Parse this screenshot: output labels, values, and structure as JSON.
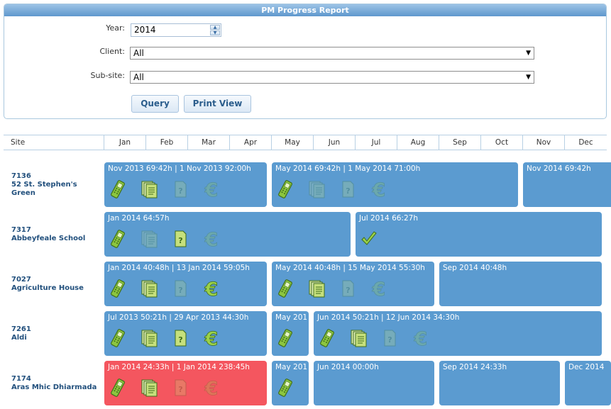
{
  "panel": {
    "title": "PM Progress Report",
    "year_label": "Year:",
    "year_value": "2014",
    "client_label": "Client:",
    "client_value": "All",
    "subsite_label": "Sub-site:",
    "subsite_value": "All",
    "query_button": "Query",
    "print_button": "Print View"
  },
  "grid": {
    "site_header": "Site",
    "months": [
      "Jan",
      "Feb",
      "Mar",
      "Apr",
      "May",
      "Jun",
      "Jul",
      "Aug",
      "Sep",
      "Oct",
      "Nov",
      "Dec"
    ]
  },
  "sites": [
    {
      "id": "7136",
      "name": "52 St. Stephen's Green"
    },
    {
      "id": "7317",
      "name": "Abbeyfeale School"
    },
    {
      "id": "7027",
      "name": "Agriculture House"
    },
    {
      "id": "7261",
      "name": "Aldi"
    },
    {
      "id": "7174",
      "name": "Aras Mhic Dhiarmada"
    }
  ],
  "cards": {
    "r0c0": "Nov 2013 69:42h | 1 Nov 2013 92:00h",
    "r0c1": "May 2014 69:42h | 1 May 2014 71:00h",
    "r0c2": "Nov 2014 69:42h",
    "r1c0": "Jan 2014 64:57h",
    "r1c1": "Jul 2014 66:27h",
    "r2c0": "Jan 2014 40:48h | 13 Jan 2014 59:05h",
    "r2c1": "May 2014 40:48h | 15 May 2014 55:30h",
    "r2c2": "Sep 2014 40:48h",
    "r3c0": "Jul 2013 50:21h | 29 Apr 2013 44:30h",
    "r3c1": "May 201",
    "r3c2": "Jun 2014 50:21h | 12 Jun 2014 34:30h",
    "r4c0": "Jan 2014 24:33h | 1 Jan 2014 238:45h",
    "r4c1": "May 201",
    "r4c2": "Jun 2014 00:00h",
    "r4c3": "Sep 2014 24:33h",
    "r4c4": "Dec 2014"
  },
  "colors": {
    "card_blue": "#5b9bd0",
    "card_red": "#f4565f",
    "header_blue": "#5f98cd",
    "site_text": "#22507d"
  },
  "icon_names": [
    "phone-icon",
    "documents-icon",
    "question-doc-icon",
    "euro-icon",
    "checkmark-icon"
  ]
}
